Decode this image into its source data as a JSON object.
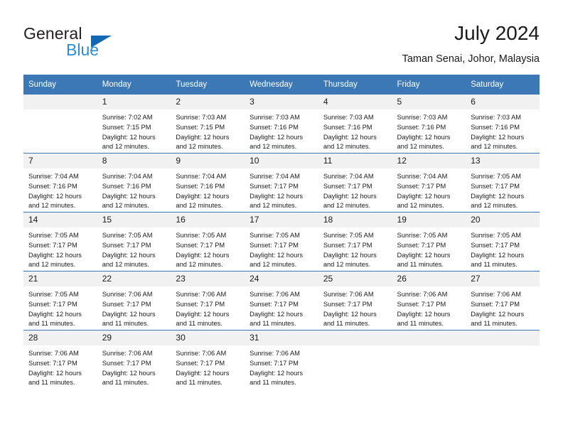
{
  "brand": {
    "name_part1": "General",
    "name_part2": "Blue",
    "triangle_color": "#1268b3",
    "blue_text_color": "#2e8bd4"
  },
  "header": {
    "title": "July 2024",
    "subtitle": "Taman Senai, Johor, Malaysia"
  },
  "theme": {
    "header_bg": "#3b78b5",
    "daynum_bg": "#f1f1f1",
    "cell_bg": "#ffffff",
    "text": "#1a1a1a"
  },
  "weekdays": [
    "Sunday",
    "Monday",
    "Tuesday",
    "Wednesday",
    "Thursday",
    "Friday",
    "Saturday"
  ],
  "weeks": [
    [
      {
        "day": "",
        "sunrise": "",
        "sunset": "",
        "daylight1": "",
        "daylight2": "",
        "blank": true
      },
      {
        "day": "1",
        "sunrise": "Sunrise: 7:02 AM",
        "sunset": "Sunset: 7:15 PM",
        "daylight1": "Daylight: 12 hours",
        "daylight2": "and 12 minutes."
      },
      {
        "day": "2",
        "sunrise": "Sunrise: 7:03 AM",
        "sunset": "Sunset: 7:15 PM",
        "daylight1": "Daylight: 12 hours",
        "daylight2": "and 12 minutes."
      },
      {
        "day": "3",
        "sunrise": "Sunrise: 7:03 AM",
        "sunset": "Sunset: 7:16 PM",
        "daylight1": "Daylight: 12 hours",
        "daylight2": "and 12 minutes."
      },
      {
        "day": "4",
        "sunrise": "Sunrise: 7:03 AM",
        "sunset": "Sunset: 7:16 PM",
        "daylight1": "Daylight: 12 hours",
        "daylight2": "and 12 minutes."
      },
      {
        "day": "5",
        "sunrise": "Sunrise: 7:03 AM",
        "sunset": "Sunset: 7:16 PM",
        "daylight1": "Daylight: 12 hours",
        "daylight2": "and 12 minutes."
      },
      {
        "day": "6",
        "sunrise": "Sunrise: 7:03 AM",
        "sunset": "Sunset: 7:16 PM",
        "daylight1": "Daylight: 12 hours",
        "daylight2": "and 12 minutes."
      }
    ],
    [
      {
        "day": "7",
        "sunrise": "Sunrise: 7:04 AM",
        "sunset": "Sunset: 7:16 PM",
        "daylight1": "Daylight: 12 hours",
        "daylight2": "and 12 minutes."
      },
      {
        "day": "8",
        "sunrise": "Sunrise: 7:04 AM",
        "sunset": "Sunset: 7:16 PM",
        "daylight1": "Daylight: 12 hours",
        "daylight2": "and 12 minutes."
      },
      {
        "day": "9",
        "sunrise": "Sunrise: 7:04 AM",
        "sunset": "Sunset: 7:16 PM",
        "daylight1": "Daylight: 12 hours",
        "daylight2": "and 12 minutes."
      },
      {
        "day": "10",
        "sunrise": "Sunrise: 7:04 AM",
        "sunset": "Sunset: 7:17 PM",
        "daylight1": "Daylight: 12 hours",
        "daylight2": "and 12 minutes."
      },
      {
        "day": "11",
        "sunrise": "Sunrise: 7:04 AM",
        "sunset": "Sunset: 7:17 PM",
        "daylight1": "Daylight: 12 hours",
        "daylight2": "and 12 minutes."
      },
      {
        "day": "12",
        "sunrise": "Sunrise: 7:04 AM",
        "sunset": "Sunset: 7:17 PM",
        "daylight1": "Daylight: 12 hours",
        "daylight2": "and 12 minutes."
      },
      {
        "day": "13",
        "sunrise": "Sunrise: 7:05 AM",
        "sunset": "Sunset: 7:17 PM",
        "daylight1": "Daylight: 12 hours",
        "daylight2": "and 12 minutes."
      }
    ],
    [
      {
        "day": "14",
        "sunrise": "Sunrise: 7:05 AM",
        "sunset": "Sunset: 7:17 PM",
        "daylight1": "Daylight: 12 hours",
        "daylight2": "and 12 minutes."
      },
      {
        "day": "15",
        "sunrise": "Sunrise: 7:05 AM",
        "sunset": "Sunset: 7:17 PM",
        "daylight1": "Daylight: 12 hours",
        "daylight2": "and 12 minutes."
      },
      {
        "day": "16",
        "sunrise": "Sunrise: 7:05 AM",
        "sunset": "Sunset: 7:17 PM",
        "daylight1": "Daylight: 12 hours",
        "daylight2": "and 12 minutes."
      },
      {
        "day": "17",
        "sunrise": "Sunrise: 7:05 AM",
        "sunset": "Sunset: 7:17 PM",
        "daylight1": "Daylight: 12 hours",
        "daylight2": "and 12 minutes."
      },
      {
        "day": "18",
        "sunrise": "Sunrise: 7:05 AM",
        "sunset": "Sunset: 7:17 PM",
        "daylight1": "Daylight: 12 hours",
        "daylight2": "and 12 minutes."
      },
      {
        "day": "19",
        "sunrise": "Sunrise: 7:05 AM",
        "sunset": "Sunset: 7:17 PM",
        "daylight1": "Daylight: 12 hours",
        "daylight2": "and 11 minutes."
      },
      {
        "day": "20",
        "sunrise": "Sunrise: 7:05 AM",
        "sunset": "Sunset: 7:17 PM",
        "daylight1": "Daylight: 12 hours",
        "daylight2": "and 11 minutes."
      }
    ],
    [
      {
        "day": "21",
        "sunrise": "Sunrise: 7:05 AM",
        "sunset": "Sunset: 7:17 PM",
        "daylight1": "Daylight: 12 hours",
        "daylight2": "and 11 minutes."
      },
      {
        "day": "22",
        "sunrise": "Sunrise: 7:06 AM",
        "sunset": "Sunset: 7:17 PM",
        "daylight1": "Daylight: 12 hours",
        "daylight2": "and 11 minutes."
      },
      {
        "day": "23",
        "sunrise": "Sunrise: 7:06 AM",
        "sunset": "Sunset: 7:17 PM",
        "daylight1": "Daylight: 12 hours",
        "daylight2": "and 11 minutes."
      },
      {
        "day": "24",
        "sunrise": "Sunrise: 7:06 AM",
        "sunset": "Sunset: 7:17 PM",
        "daylight1": "Daylight: 12 hours",
        "daylight2": "and 11 minutes."
      },
      {
        "day": "25",
        "sunrise": "Sunrise: 7:06 AM",
        "sunset": "Sunset: 7:17 PM",
        "daylight1": "Daylight: 12 hours",
        "daylight2": "and 11 minutes."
      },
      {
        "day": "26",
        "sunrise": "Sunrise: 7:06 AM",
        "sunset": "Sunset: 7:17 PM",
        "daylight1": "Daylight: 12 hours",
        "daylight2": "and 11 minutes."
      },
      {
        "day": "27",
        "sunrise": "Sunrise: 7:06 AM",
        "sunset": "Sunset: 7:17 PM",
        "daylight1": "Daylight: 12 hours",
        "daylight2": "and 11 minutes."
      }
    ],
    [
      {
        "day": "28",
        "sunrise": "Sunrise: 7:06 AM",
        "sunset": "Sunset: 7:17 PM",
        "daylight1": "Daylight: 12 hours",
        "daylight2": "and 11 minutes."
      },
      {
        "day": "29",
        "sunrise": "Sunrise: 7:06 AM",
        "sunset": "Sunset: 7:17 PM",
        "daylight1": "Daylight: 12 hours",
        "daylight2": "and 11 minutes."
      },
      {
        "day": "30",
        "sunrise": "Sunrise: 7:06 AM",
        "sunset": "Sunset: 7:17 PM",
        "daylight1": "Daylight: 12 hours",
        "daylight2": "and 11 minutes."
      },
      {
        "day": "31",
        "sunrise": "Sunrise: 7:06 AM",
        "sunset": "Sunset: 7:17 PM",
        "daylight1": "Daylight: 12 hours",
        "daylight2": "and 11 minutes."
      },
      {
        "day": "",
        "sunrise": "",
        "sunset": "",
        "daylight1": "",
        "daylight2": "",
        "blank": true
      },
      {
        "day": "",
        "sunrise": "",
        "sunset": "",
        "daylight1": "",
        "daylight2": "",
        "blank": true
      },
      {
        "day": "",
        "sunrise": "",
        "sunset": "",
        "daylight1": "",
        "daylight2": "",
        "blank": true
      }
    ]
  ]
}
